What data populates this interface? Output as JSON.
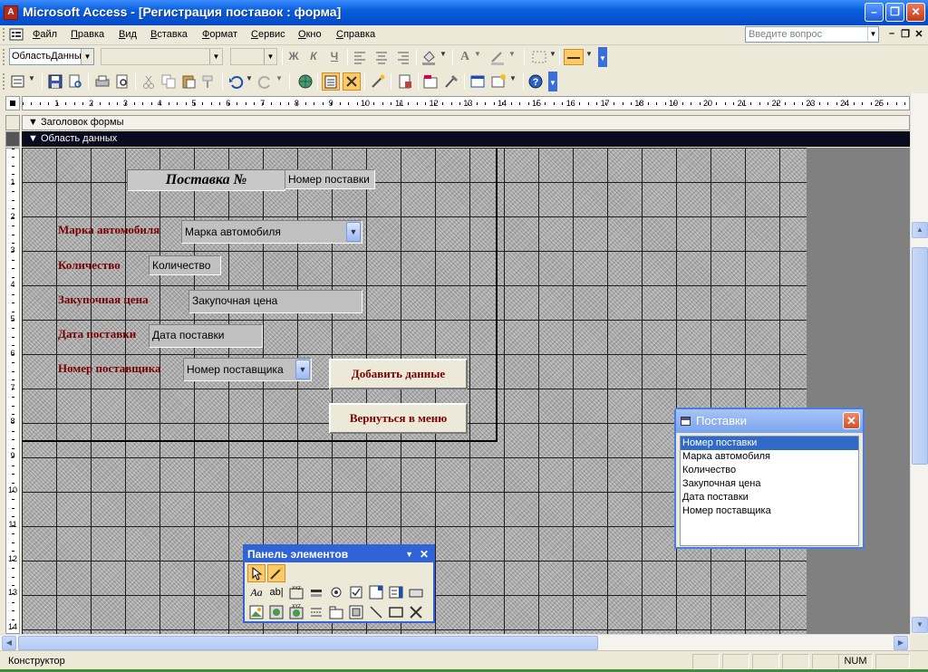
{
  "window": {
    "title": "Microsoft Access - [Регистрация поставок : форма]",
    "app_icon_glyph": "A"
  },
  "menu": {
    "items": [
      "Файл",
      "Правка",
      "Вид",
      "Вставка",
      "Формат",
      "Сервис",
      "Окно",
      "Справка"
    ]
  },
  "question_box": {
    "placeholder": "Введите вопрос"
  },
  "formatting_toolbar": {
    "object_combo": "ОбластьДанны",
    "font_combo": "",
    "size_combo": "",
    "bold": "Ж",
    "italic": "К",
    "underline": "Ч",
    "font_color_letter": "A"
  },
  "ruler": {
    "h_labels": [
      "1",
      "2",
      "3",
      "4",
      "5",
      "6",
      "7",
      "8",
      "9",
      "10",
      "11",
      "12",
      "13",
      "14",
      "15",
      "16",
      "17",
      "18",
      "19",
      "20",
      "21",
      "22",
      "23",
      "24",
      "25"
    ],
    "v_labels": [
      "1",
      "2",
      "3",
      "4",
      "5",
      "6",
      "7",
      "8",
      "9",
      "10",
      "11",
      "12",
      "13",
      "14"
    ]
  },
  "sections": {
    "header": "Заголовок формы",
    "data": "Область данных"
  },
  "form": {
    "title_label": "Поставка №",
    "title_field": "Номер поставки",
    "rows": [
      {
        "label": "Марка автомобиля",
        "field": "Марка автомобиля"
      },
      {
        "label": "Количество",
        "field": "Количество"
      },
      {
        "label": "Закупочная цена",
        "field": "Закупочная цена"
      },
      {
        "label": "Дата поставки",
        "field": "Дата поставки"
      },
      {
        "label": "Номер поставщика",
        "field": "Номер поставщика"
      }
    ],
    "buttons": {
      "add": "Добавить данные",
      "back": "Вернуться в меню"
    }
  },
  "field_list": {
    "title": "Поставки",
    "items": [
      "Номер поставки",
      "Марка автомобиля",
      "Количество",
      "Закупочная цена",
      "Дата поставки",
      "Номер поставщика"
    ],
    "selected_index": 0
  },
  "toolbox": {
    "title": "Панель элементов"
  },
  "status": {
    "text": "Конструктор",
    "num": "NUM"
  },
  "colors": {
    "label": "#7a0000",
    "titlebar": "#0a5fdc",
    "selection": "#316ac5"
  }
}
